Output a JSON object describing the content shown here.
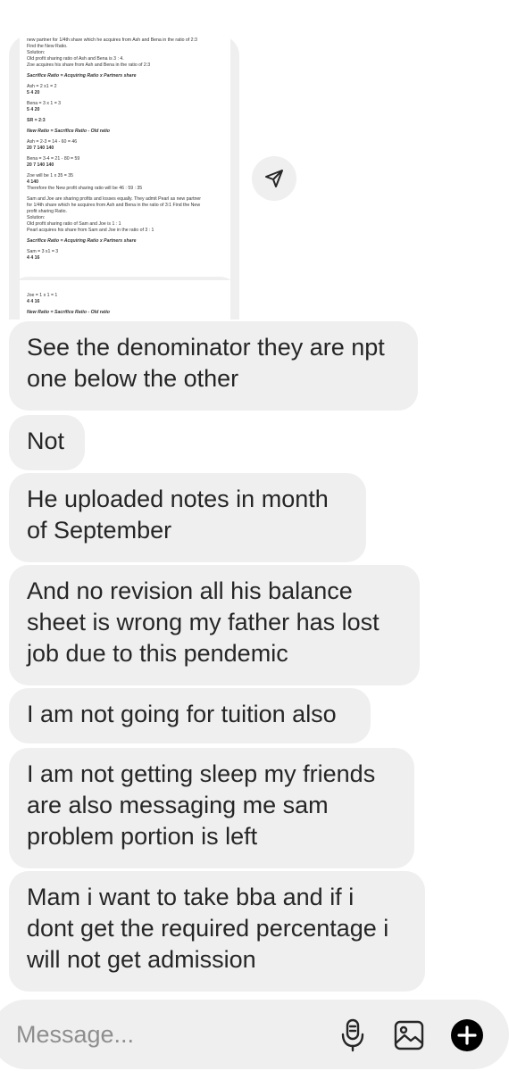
{
  "attachment_1": {
    "lines": [
      "new partner for 1/4th share which he acquires from Ash and Bena in the ratio of 2:3",
      "Find the New Ratio.",
      "Solution:",
      "Old profit sharing ratio of Ash and Bena is 3 : 4.",
      "Zoe acquires his share from Ash and Bena in the ratio of 2:3",
      "Sacrifice Ratio = Acquiring Ratio x Partners share",
      "Ash = 2 x1 = 2",
      "5 4 20",
      "Bena = 3 x 1 = 3",
      "5 4 20",
      "SR = 2:3",
      "New Ratio = Sacrifice Ratio - Old ratio",
      "Ash = 2-3 = 14 - 60 = 46",
      "20 7 140 140",
      "Bena = 3-4 = 21 - 80 = 59",
      "20 7 140 140",
      "Zoe will be 1 x 35 = 35",
      "4 140",
      "Therefore the New profit sharing ratio will be 46 : 59 : 35",
      "Sam and Joe are sharing profits and losses equally. They admit Pearl as new partner",
      "for 1/4th share which he acquires from Ash and Bena in the ratio of 3:1 Find the New",
      "profit sharing Ratio.",
      "Solution:",
      "Old profit sharing ratio of Sam and Joe is 1 : 1",
      "Pearl acquires his share from Sam and Joe in the ratio of 3 : 1",
      "Sacrifice Ratio = Acquiring Ratio x Partners share",
      "Sam = 3 x1 = 3",
      "4 4 16"
    ]
  },
  "attachment_2": {
    "lines": [
      "Joe = 1 x 1 = 1",
      "4 4 16",
      "New Ratio = Sacrifice Ratio - Old ratio"
    ]
  },
  "messages": [
    "See the denominator they are npt one below the other",
    "Not",
    "He uploaded notes in month of September",
    "And no revision all his balance sheet is wrong my father has lost job due to this pendemic",
    "I am not going for tuition also",
    "I am not getting sleep my friends are also messaging me sam problem portion is left",
    "Mam i want to take bba and if i dont get the required percentage i will not get admission"
  ],
  "composer": {
    "placeholder": "Message...",
    "icons": [
      "microphone-icon",
      "gallery-icon",
      "plus-icon"
    ]
  },
  "colors": {
    "bubble": "#efefef",
    "text": "#262626",
    "placeholder": "#8e8e8e",
    "accent": "#000000"
  }
}
